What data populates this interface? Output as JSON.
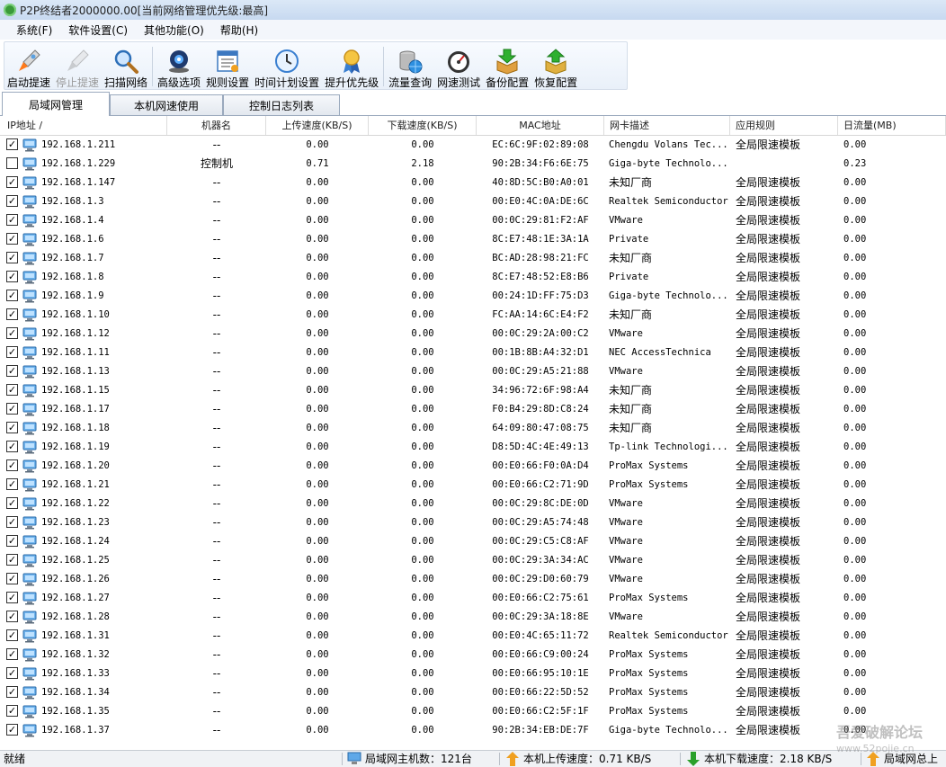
{
  "window": {
    "title": "P2P终结者2000000.00[当前网络管理优先级:最高]"
  },
  "menu": [
    "系统(F)",
    "软件设置(C)",
    "其他功能(O)",
    "帮助(H)"
  ],
  "toolbar": [
    {
      "label": "启动提速",
      "icon": "rocket-icon",
      "enabled": true
    },
    {
      "label": "停止提速",
      "icon": "rocket-stop-icon",
      "enabled": false
    },
    {
      "label": "扫描网络",
      "icon": "magnifier-icon",
      "enabled": true
    },
    {
      "label": "高级选项",
      "icon": "webcam-icon",
      "enabled": true
    },
    {
      "label": "规则设置",
      "icon": "rules-icon",
      "enabled": true
    },
    {
      "label": "时间计划设置",
      "icon": "clock-icon",
      "enabled": true
    },
    {
      "label": "提升优先级",
      "icon": "medal-icon",
      "enabled": true
    },
    {
      "label": "流量查询",
      "icon": "database-globe-icon",
      "enabled": true
    },
    {
      "label": "网速测试",
      "icon": "speedometer-icon",
      "enabled": true
    },
    {
      "label": "备份配置",
      "icon": "box-down-icon",
      "enabled": true
    },
    {
      "label": "恢复配置",
      "icon": "box-up-icon",
      "enabled": true
    }
  ],
  "tabs": [
    "局域网管理",
    "本机网速使用",
    "控制日志列表"
  ],
  "columns": [
    "IP地址  /",
    "机器名",
    "上传速度(KB/S)",
    "下载速度(KB/S)",
    "MAC地址",
    "网卡描述",
    "应用规则",
    "日流量(MB)"
  ],
  "rows": [
    {
      "checked": true,
      "ip": "192.168.1.211",
      "name": "--",
      "up": "0.00",
      "down": "0.00",
      "mac": "EC:6C:9F:02:89:08",
      "nic": "Chengdu Volans Tec...",
      "rule": "全局限速模板",
      "traffic": "0.00"
    },
    {
      "checked": false,
      "ip": "192.168.1.229",
      "name": "控制机",
      "up": "0.71",
      "down": "2.18",
      "mac": "90:2B:34:F6:6E:75",
      "nic": "Giga-byte Technolo...",
      "rule": "",
      "traffic": "0.23"
    },
    {
      "checked": true,
      "ip": "192.168.1.147",
      "name": "--",
      "up": "0.00",
      "down": "0.00",
      "mac": "40:8D:5C:B0:A0:01",
      "nic": "未知厂商",
      "rule": "全局限速模板",
      "traffic": "0.00"
    },
    {
      "checked": true,
      "ip": "192.168.1.3",
      "name": "--",
      "up": "0.00",
      "down": "0.00",
      "mac": "00:E0:4C:0A:DE:6C",
      "nic": "Realtek Semiconductor",
      "rule": "全局限速模板",
      "traffic": "0.00"
    },
    {
      "checked": true,
      "ip": "192.168.1.4",
      "name": "--",
      "up": "0.00",
      "down": "0.00",
      "mac": "00:0C:29:81:F2:AF",
      "nic": "VMware",
      "rule": "全局限速模板",
      "traffic": "0.00"
    },
    {
      "checked": true,
      "ip": "192.168.1.6",
      "name": "--",
      "up": "0.00",
      "down": "0.00",
      "mac": "8C:E7:48:1E:3A:1A",
      "nic": "Private",
      "rule": "全局限速模板",
      "traffic": "0.00"
    },
    {
      "checked": true,
      "ip": "192.168.1.7",
      "name": "--",
      "up": "0.00",
      "down": "0.00",
      "mac": "BC:AD:28:98:21:FC",
      "nic": "未知厂商",
      "rule": "全局限速模板",
      "traffic": "0.00"
    },
    {
      "checked": true,
      "ip": "192.168.1.8",
      "name": "--",
      "up": "0.00",
      "down": "0.00",
      "mac": "8C:E7:48:52:E8:B6",
      "nic": "Private",
      "rule": "全局限速模板",
      "traffic": "0.00"
    },
    {
      "checked": true,
      "ip": "192.168.1.9",
      "name": "--",
      "up": "0.00",
      "down": "0.00",
      "mac": "00:24:1D:FF:75:D3",
      "nic": "Giga-byte Technolo...",
      "rule": "全局限速模板",
      "traffic": "0.00"
    },
    {
      "checked": true,
      "ip": "192.168.1.10",
      "name": "--",
      "up": "0.00",
      "down": "0.00",
      "mac": "FC:AA:14:6C:E4:F2",
      "nic": "未知厂商",
      "rule": "全局限速模板",
      "traffic": "0.00"
    },
    {
      "checked": true,
      "ip": "192.168.1.12",
      "name": "--",
      "up": "0.00",
      "down": "0.00",
      "mac": "00:0C:29:2A:00:C2",
      "nic": "VMware",
      "rule": "全局限速模板",
      "traffic": "0.00"
    },
    {
      "checked": true,
      "ip": "192.168.1.11",
      "name": "--",
      "up": "0.00",
      "down": "0.00",
      "mac": "00:1B:8B:A4:32:D1",
      "nic": "NEC AccessTechnica",
      "rule": "全局限速模板",
      "traffic": "0.00"
    },
    {
      "checked": true,
      "ip": "192.168.1.13",
      "name": "--",
      "up": "0.00",
      "down": "0.00",
      "mac": "00:0C:29:A5:21:88",
      "nic": "VMware",
      "rule": "全局限速模板",
      "traffic": "0.00"
    },
    {
      "checked": true,
      "ip": "192.168.1.15",
      "name": "--",
      "up": "0.00",
      "down": "0.00",
      "mac": "34:96:72:6F:98:A4",
      "nic": "未知厂商",
      "rule": "全局限速模板",
      "traffic": "0.00"
    },
    {
      "checked": true,
      "ip": "192.168.1.17",
      "name": "--",
      "up": "0.00",
      "down": "0.00",
      "mac": "F0:B4:29:8D:C8:24",
      "nic": "未知厂商",
      "rule": "全局限速模板",
      "traffic": "0.00"
    },
    {
      "checked": true,
      "ip": "192.168.1.18",
      "name": "--",
      "up": "0.00",
      "down": "0.00",
      "mac": "64:09:80:47:08:75",
      "nic": "未知厂商",
      "rule": "全局限速模板",
      "traffic": "0.00"
    },
    {
      "checked": true,
      "ip": "192.168.1.19",
      "name": "--",
      "up": "0.00",
      "down": "0.00",
      "mac": "D8:5D:4C:4E:49:13",
      "nic": "Tp-link Technologi...",
      "rule": "全局限速模板",
      "traffic": "0.00"
    },
    {
      "checked": true,
      "ip": "192.168.1.20",
      "name": "--",
      "up": "0.00",
      "down": "0.00",
      "mac": "00:E0:66:F0:0A:D4",
      "nic": "ProMax Systems",
      "rule": "全局限速模板",
      "traffic": "0.00"
    },
    {
      "checked": true,
      "ip": "192.168.1.21",
      "name": "--",
      "up": "0.00",
      "down": "0.00",
      "mac": "00:E0:66:C2:71:9D",
      "nic": "ProMax Systems",
      "rule": "全局限速模板",
      "traffic": "0.00"
    },
    {
      "checked": true,
      "ip": "192.168.1.22",
      "name": "--",
      "up": "0.00",
      "down": "0.00",
      "mac": "00:0C:29:8C:DE:0D",
      "nic": "VMware",
      "rule": "全局限速模板",
      "traffic": "0.00"
    },
    {
      "checked": true,
      "ip": "192.168.1.23",
      "name": "--",
      "up": "0.00",
      "down": "0.00",
      "mac": "00:0C:29:A5:74:48",
      "nic": "VMware",
      "rule": "全局限速模板",
      "traffic": "0.00"
    },
    {
      "checked": true,
      "ip": "192.168.1.24",
      "name": "--",
      "up": "0.00",
      "down": "0.00",
      "mac": "00:0C:29:C5:C8:AF",
      "nic": "VMware",
      "rule": "全局限速模板",
      "traffic": "0.00"
    },
    {
      "checked": true,
      "ip": "192.168.1.25",
      "name": "--",
      "up": "0.00",
      "down": "0.00",
      "mac": "00:0C:29:3A:34:AC",
      "nic": "VMware",
      "rule": "全局限速模板",
      "traffic": "0.00"
    },
    {
      "checked": true,
      "ip": "192.168.1.26",
      "name": "--",
      "up": "0.00",
      "down": "0.00",
      "mac": "00:0C:29:D0:60:79",
      "nic": "VMware",
      "rule": "全局限速模板",
      "traffic": "0.00"
    },
    {
      "checked": true,
      "ip": "192.168.1.27",
      "name": "--",
      "up": "0.00",
      "down": "0.00",
      "mac": "00:E0:66:C2:75:61",
      "nic": "ProMax Systems",
      "rule": "全局限速模板",
      "traffic": "0.00"
    },
    {
      "checked": true,
      "ip": "192.168.1.28",
      "name": "--",
      "up": "0.00",
      "down": "0.00",
      "mac": "00:0C:29:3A:18:8E",
      "nic": "VMware",
      "rule": "全局限速模板",
      "traffic": "0.00"
    },
    {
      "checked": true,
      "ip": "192.168.1.31",
      "name": "--",
      "up": "0.00",
      "down": "0.00",
      "mac": "00:E0:4C:65:11:72",
      "nic": "Realtek Semiconductor",
      "rule": "全局限速模板",
      "traffic": "0.00"
    },
    {
      "checked": true,
      "ip": "192.168.1.32",
      "name": "--",
      "up": "0.00",
      "down": "0.00",
      "mac": "00:E0:66:C9:00:24",
      "nic": "ProMax Systems",
      "rule": "全局限速模板",
      "traffic": "0.00"
    },
    {
      "checked": true,
      "ip": "192.168.1.33",
      "name": "--",
      "up": "0.00",
      "down": "0.00",
      "mac": "00:E0:66:95:10:1E",
      "nic": "ProMax Systems",
      "rule": "全局限速模板",
      "traffic": "0.00"
    },
    {
      "checked": true,
      "ip": "192.168.1.34",
      "name": "--",
      "up": "0.00",
      "down": "0.00",
      "mac": "00:E0:66:22:5D:52",
      "nic": "ProMax Systems",
      "rule": "全局限速模板",
      "traffic": "0.00"
    },
    {
      "checked": true,
      "ip": "192.168.1.35",
      "name": "--",
      "up": "0.00",
      "down": "0.00",
      "mac": "00:E0:66:C2:5F:1F",
      "nic": "ProMax Systems",
      "rule": "全局限速模板",
      "traffic": "0.00"
    },
    {
      "checked": true,
      "ip": "192.168.1.37",
      "name": "--",
      "up": "0.00",
      "down": "0.00",
      "mac": "90:2B:34:EB:DE:7F",
      "nic": "Giga-byte Technolo...",
      "rule": "全局限速模板",
      "traffic": "0.00"
    }
  ],
  "status": {
    "state": "就绪",
    "host_count": "局域网主机数：121台",
    "upload": "本机上传速度：0.71 KB/S",
    "download": "本机下载速度：2.18 KB/S",
    "lan_total": "局域网总上"
  },
  "watermark": {
    "line1": "吾爱破解论坛",
    "line2": "www.52pojie.cn"
  },
  "colors": {
    "accent": "#c7d9f0",
    "check": "#000000",
    "upload_arrow": "#f0a020",
    "download_arrow": "#2aa02a"
  }
}
